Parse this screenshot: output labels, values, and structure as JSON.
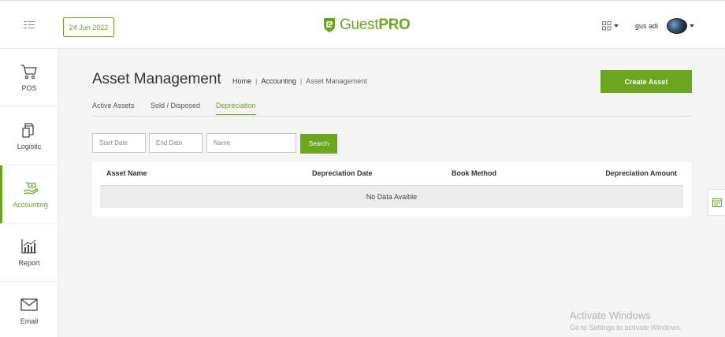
{
  "header": {
    "date": "24 Jun 2022",
    "logo": {
      "light": "Guest",
      "bold": "PRO"
    },
    "username": "gus adi",
    "menu_icon": "menu-list-icon",
    "apps_icon": "grid-apps-icon"
  },
  "sidebar": {
    "items": [
      {
        "label": "POS",
        "icon": "cart-icon"
      },
      {
        "label": "Logistic",
        "icon": "boxes-icon"
      },
      {
        "label": "Accounting",
        "icon": "money-hand-icon",
        "active": true
      },
      {
        "label": "Report",
        "icon": "bar-chart-icon"
      },
      {
        "label": "Email",
        "icon": "envelope-icon"
      }
    ]
  },
  "page": {
    "title": "Asset Management",
    "breadcrumb": [
      "Home",
      "Accounting",
      "Asset Management"
    ],
    "create_button": "Create Asset"
  },
  "tabs": [
    {
      "label": "Active Assets"
    },
    {
      "label": "Sold / Disposed"
    },
    {
      "label": "Depreciation",
      "active": true
    }
  ],
  "filters": {
    "start_date": "Start Date",
    "end_date": "End Date",
    "name": "Name",
    "search_button": "Search"
  },
  "table": {
    "columns": [
      "Asset Name",
      "Depreciation Date",
      "Book Method",
      "Depreciation Amount"
    ],
    "empty_message": "No Data Avaible"
  },
  "watermark": {
    "line1": "Activate Windows",
    "line2": "Go to Settings to activate Windows."
  },
  "colors": {
    "accent": "#6aa61e",
    "background": "#f4f4f4"
  }
}
